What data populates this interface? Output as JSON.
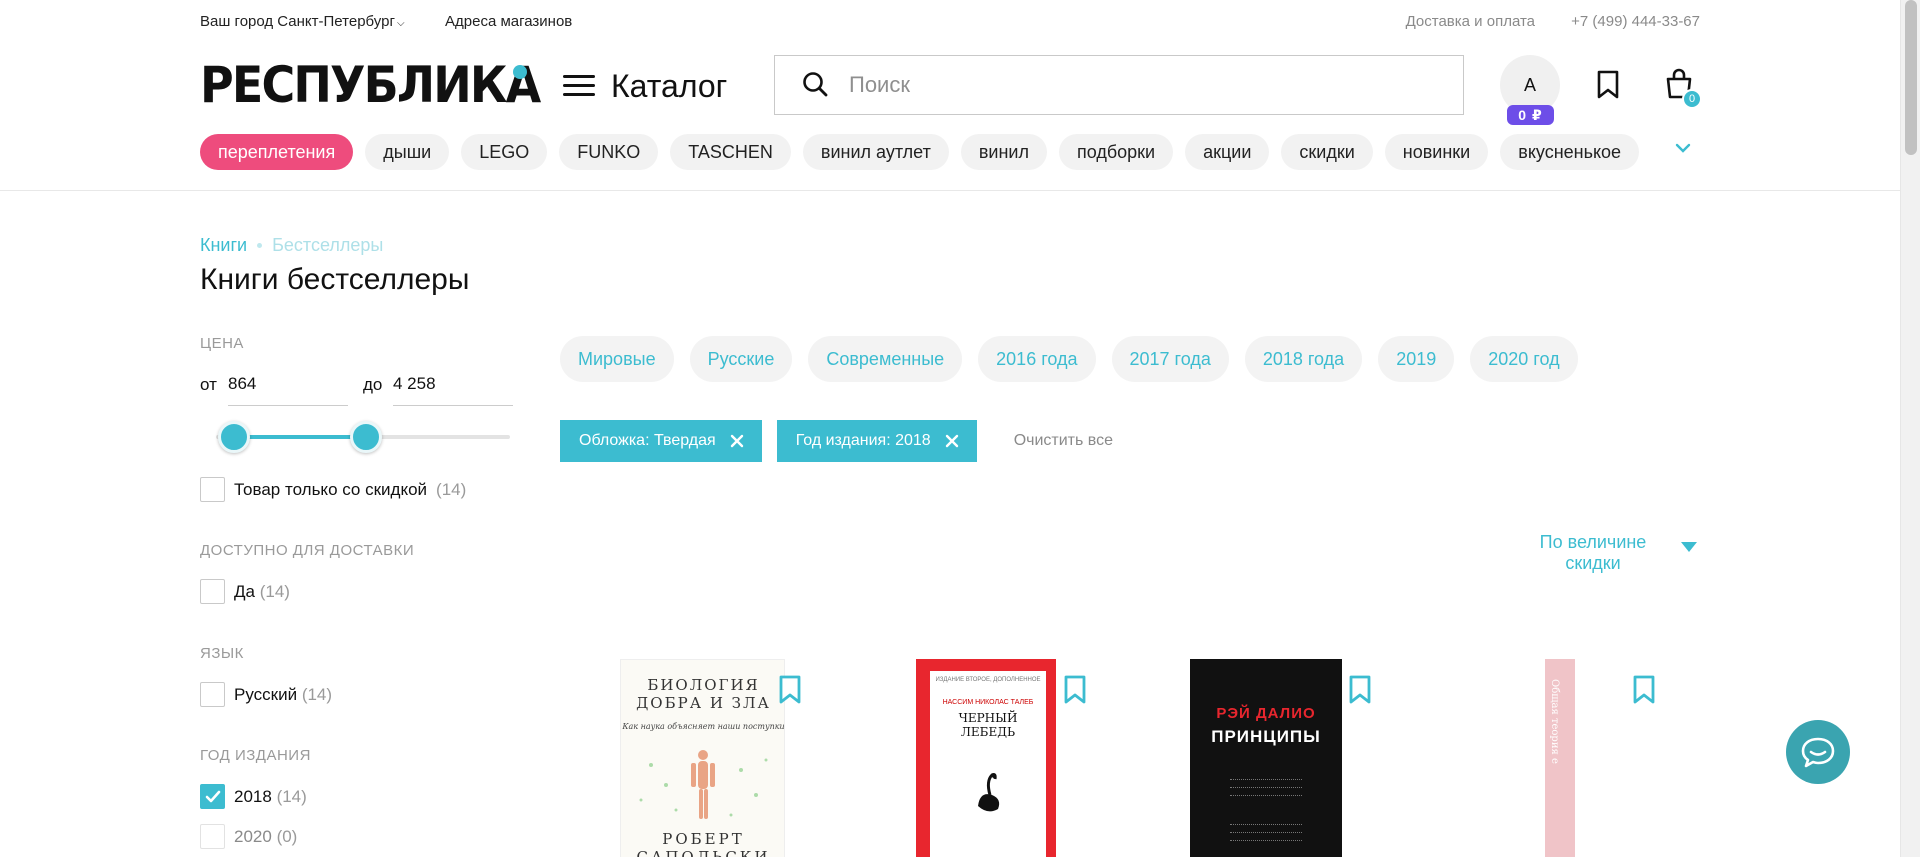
{
  "topbar": {
    "city": "Ваш город Санкт-Петербург",
    "stores": "Адреса магазинов",
    "delivery": "Доставка и оплата",
    "phone": "+7 (499) 444-33-67"
  },
  "header": {
    "logo": "РЕСПУБЛИКА",
    "catalog": "Каталог",
    "search_placeholder": "Поиск",
    "avatar_letter": "A",
    "avatar_badge": "0 ₽",
    "cart_count": "0"
  },
  "chips": [
    "переплетения",
    "дыши",
    "LEGO",
    "FUNKO",
    "TASCHEN",
    "винил аутлет",
    "винил",
    "подборки",
    "акции",
    "скидки",
    "новинки",
    "вкусненькое"
  ],
  "breadcrumbs": [
    "Книги",
    "Бестселлеры"
  ],
  "page_title": "Книги бестселлеры",
  "filters": {
    "price": {
      "label": "ЦЕНА",
      "from_label": "от",
      "from": "864",
      "to_label": "до",
      "to": "4 258",
      "range_fraction": [
        0.06,
        0.51
      ]
    },
    "discount_only": {
      "label": "Товар только со скидкой",
      "count": "(14)",
      "checked": false
    },
    "delivery": {
      "label": "ДОСТУПНО ДЛЯ ДОСТАВКИ",
      "option": "Да",
      "count": "(14)",
      "checked": false
    },
    "language": {
      "label": "ЯЗЫК",
      "option": "Русский",
      "count": "(14)",
      "checked": false
    },
    "year": {
      "label": "ГОД ИЗДАНИЯ",
      "options": [
        {
          "label": "2018",
          "count": "(14)",
          "checked": true
        },
        {
          "label": "2020",
          "count": "(0)",
          "checked": false
        }
      ]
    }
  },
  "tags": [
    "Мировые",
    "Русские",
    "Современные",
    "2016 года",
    "2017 года",
    "2018 года",
    "2019",
    "2020 год"
  ],
  "active_filters": [
    "Обложка: Твердая",
    "Год издания: 2018"
  ],
  "clear_all": "Очистить все",
  "sort": {
    "label": "По величине скидки"
  },
  "products": [
    {
      "cover_title": "БИОЛОГИЯ ДОБРА И ЗЛА",
      "cover_subtitle": "Как наука объясняет наши поступки",
      "cover_author": "РОБЕРТ САПОЛЬСКИ"
    },
    {
      "cover_author": "НАССИМ НИКОЛАС ТАЛЕБ",
      "cover_title": "ЧЕРНЫЙ ЛЕБЕДЬ",
      "cover_note": "ИЗДАНИЕ ВТОРОЕ, ДОПОЛНЕННОЕ"
    },
    {
      "cover_author": "РЭЙ ДАЛИО",
      "cover_title": "ПРИНЦИПЫ"
    },
    {
      "cover_title": "Общая теория e"
    }
  ],
  "colors": {
    "accent": "#3cbcd0",
    "chip_active": "#ee4c7d",
    "badge": "#6d4ee8",
    "chat": "#3aa4b0"
  }
}
